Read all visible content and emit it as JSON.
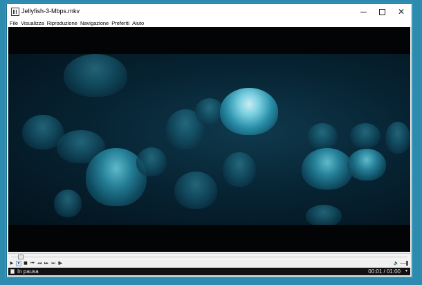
{
  "window": {
    "title": "Jellyfish-3-Mbps.mkv"
  },
  "titlebar_buttons": {
    "close_glyph": "✕"
  },
  "menu": {
    "items": [
      "File",
      "Visualizza",
      "Riproduzione",
      "Navigazione",
      "Preferiti",
      "Aiuto"
    ]
  },
  "controls": {
    "play_glyph": "▶",
    "pause_glyph": "⏸",
    "stop_glyph": "■",
    "skip_back_glyph": "⏮",
    "rewind_glyph": "◂◂",
    "forward_glyph": "▸▸",
    "skip_forward_glyph": "⏭",
    "frame_step_glyph": "▮▸",
    "speaker_glyph": "🔈",
    "volume_level": 0.8
  },
  "seek": {
    "position_fraction": 0.017
  },
  "status": {
    "state": "In pausa",
    "time": "00:01 / 01:00",
    "arrow": "▾"
  },
  "icons": {
    "app": "media-player-icon",
    "minimize": "minimize-icon",
    "maximize": "maximize-icon",
    "close": "close-icon"
  },
  "colors": {
    "desktop": "#2e8bb0",
    "status_bg": "#111111",
    "video_bg": "#020406"
  }
}
